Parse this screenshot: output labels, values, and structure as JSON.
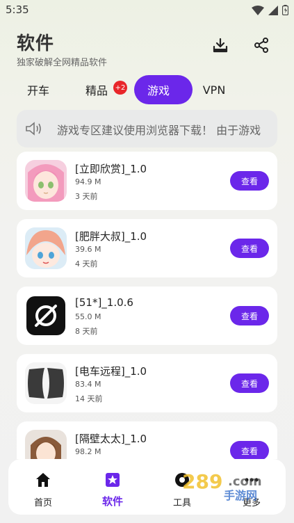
{
  "status_bar": {
    "time": "5:35"
  },
  "header": {
    "title": "软件",
    "subtitle": "独家破解全网精品软件",
    "download_icon": "download-icon",
    "share_icon": "share-icon"
  },
  "tabs": [
    {
      "label": "开车"
    },
    {
      "label": "精品",
      "badge": "+2"
    },
    {
      "label": "游戏"
    },
    {
      "label": "VPN"
    }
  ],
  "notice": {
    "icon": "speaker-icon",
    "text": "游戏专区建议使用浏览器下载！ 由于游戏"
  },
  "apps": [
    {
      "name": "[立即欣赏]_1.0",
      "size": "94.9 M",
      "time": "3 天前",
      "button": "查看"
    },
    {
      "name": "[肥胖大叔]_1.0",
      "size": "39.6 M",
      "time": "4 天前",
      "button": "查看"
    },
    {
      "name": "[51*]_1.0.6",
      "size": "55.0 M",
      "time": "8 天前",
      "button": "查看"
    },
    {
      "name": "[电车远程]_1.0",
      "size": "83.4 M",
      "time": "14 天前",
      "button": "查看"
    },
    {
      "name": "[隔壁太太]_1.0",
      "size": "98.2 M",
      "time": "",
      "button": "查看"
    }
  ],
  "bottom_nav": [
    {
      "label": "首页",
      "icon": "home-icon"
    },
    {
      "label": "软件",
      "icon": "star-badge-icon"
    },
    {
      "label": "工具",
      "icon": "tool-icon"
    },
    {
      "label": "更多",
      "icon": "more-icon"
    }
  ],
  "watermark": "289 手游网",
  "colors": {
    "accent": "#6b27ea",
    "badge": "#e8262a",
    "card": "#ffffff"
  }
}
